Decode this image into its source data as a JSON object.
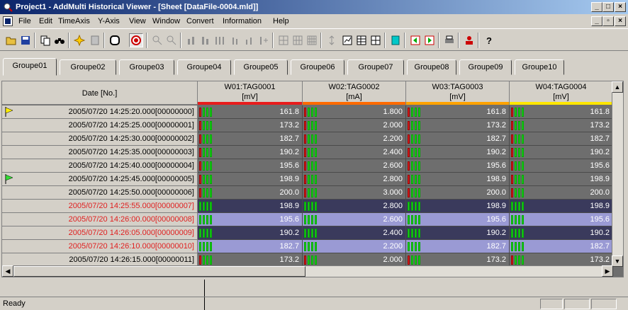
{
  "window": {
    "title": "Project1 - AddMulti Historical Viewer - [Sheet [DataFile-0004.mld]]"
  },
  "menu": [
    "File",
    "Edit",
    "TimeAxis",
    "Y-Axis",
    "View",
    "Window",
    "Convert",
    "Information",
    "Help"
  ],
  "tabs": [
    "Groupe01",
    "Groupe02",
    "Groupe03",
    "Groupe04",
    "Groupe05",
    "Groupe06",
    "Groupe07",
    "Groupe08",
    "Groupe09",
    "Groupe10"
  ],
  "active_tab": "Groupe01",
  "grid": {
    "date_header": "Date [No.]",
    "columns": [
      {
        "name": "W01:TAG0001",
        "unit": "[mV]",
        "color": "#e81c1c"
      },
      {
        "name": "W02:TAG0002",
        "unit": "[mA]",
        "color": "#ff6a00"
      },
      {
        "name": "W03:TAG0003",
        "unit": "[mV]",
        "color": "#ffa200"
      },
      {
        "name": "W04:TAG0004",
        "unit": "[mV]",
        "color": "#ffe600"
      }
    ],
    "rows": [
      {
        "date": "2005/07/20 14:25:20.000[00000000]",
        "values": [
          "161.8",
          "1.800",
          "161.8",
          "161.8"
        ],
        "flag": "yellow",
        "selected": false
      },
      {
        "date": "2005/07/20 14:25:25.000[00000001]",
        "values": [
          "173.2",
          "2.000",
          "173.2",
          "173.2"
        ],
        "flag": "",
        "selected": false
      },
      {
        "date": "2005/07/20 14:25:30.000[00000002]",
        "values": [
          "182.7",
          "2.200",
          "182.7",
          "182.7"
        ],
        "flag": "",
        "selected": false
      },
      {
        "date": "2005/07/20 14:25:35.000[00000003]",
        "values": [
          "190.2",
          "2.400",
          "190.2",
          "190.2"
        ],
        "flag": "",
        "selected": false
      },
      {
        "date": "2005/07/20 14:25:40.000[00000004]",
        "values": [
          "195.6",
          "2.600",
          "195.6",
          "195.6"
        ],
        "flag": "",
        "selected": false
      },
      {
        "date": "2005/07/20 14:25:45.000[00000005]",
        "values": [
          "198.9",
          "2.800",
          "198.9",
          "198.9"
        ],
        "flag": "green",
        "selected": false
      },
      {
        "date": "2005/07/20 14:25:50.000[00000006]",
        "values": [
          "200.0",
          "3.000",
          "200.0",
          "200.0"
        ],
        "flag": "",
        "selected": false
      },
      {
        "date": "2005/07/20 14:25:55.000[00000007]",
        "values": [
          "198.9",
          "2.800",
          "198.9",
          "198.9"
        ],
        "flag": "",
        "selected": true
      },
      {
        "date": "2005/07/20 14:26:00.000[00000008]",
        "values": [
          "195.6",
          "2.600",
          "195.6",
          "195.6"
        ],
        "flag": "",
        "selected": true
      },
      {
        "date": "2005/07/20 14:26:05.000[00000009]",
        "values": [
          "190.2",
          "2.400",
          "190.2",
          "190.2"
        ],
        "flag": "",
        "selected": true
      },
      {
        "date": "2005/07/20 14:26:10.000[00000010]",
        "values": [
          "182.7",
          "2.200",
          "182.7",
          "182.7"
        ],
        "flag": "",
        "selected": true
      },
      {
        "date": "2005/07/20 14:26:15.000[00000011]",
        "values": [
          "173.2",
          "2.000",
          "173.2",
          "173.2"
        ],
        "flag": "",
        "selected": false
      }
    ]
  },
  "status": {
    "text": "Ready"
  }
}
